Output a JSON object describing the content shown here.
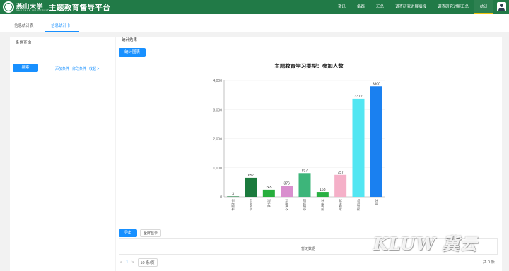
{
  "header": {
    "univ_name": "燕山大学",
    "univ_sub": "YANSHAN UNIVERSITY",
    "app_title": "主题教育督导平台",
    "nav": [
      "资讯",
      "备西",
      "汇总",
      "调查研究进展填报",
      "调查研究进展汇总",
      "统计"
    ]
  },
  "subtabs": [
    "信息统计表",
    "信息统计卡"
  ],
  "left_panel": {
    "title": "条件查询",
    "search_button": "搜索",
    "links": [
      "添加条件",
      "修改条件",
      "收起 >"
    ]
  },
  "right_panel": {
    "title": "统计结果",
    "stat_button": "统计图表"
  },
  "chart_data": {
    "type": "bar",
    "title": "主题教育学习类型：参加人数",
    "categories": [
      "专题讲座",
      "专题研讨",
      "读书班",
      "交流研讨",
      "专题党课",
      "现场教学",
      "调查研究",
      "实践活动",
      "自学"
    ],
    "values": [
      3,
      657,
      245,
      376,
      817,
      168,
      757,
      3372,
      3800
    ],
    "value_labels": [
      "3",
      "657",
      "245",
      "376",
      "817",
      "168",
      "757",
      "3372",
      "3800"
    ],
    "colors": [
      "#1b7a3d",
      "#1b7a3d",
      "#27ae3c",
      "#d98fce",
      "#3db57a",
      "#2ab043",
      "#f5b0c8",
      "#52e6f2",
      "#1a80f0"
    ],
    "yticks": [
      "0",
      "1,000",
      "2,000",
      "3,000",
      "4,000"
    ],
    "ylim": [
      0,
      4000
    ]
  },
  "table": {
    "export_button": "导出",
    "fullscreen_button": "全屏显示",
    "empty_text": "暂无数据"
  },
  "pagination": {
    "prev": "<",
    "page": "1",
    "next": ">",
    "page_size": "10 条/页",
    "total": "共 0 条"
  },
  "watermark": "KLUW 冀云"
}
